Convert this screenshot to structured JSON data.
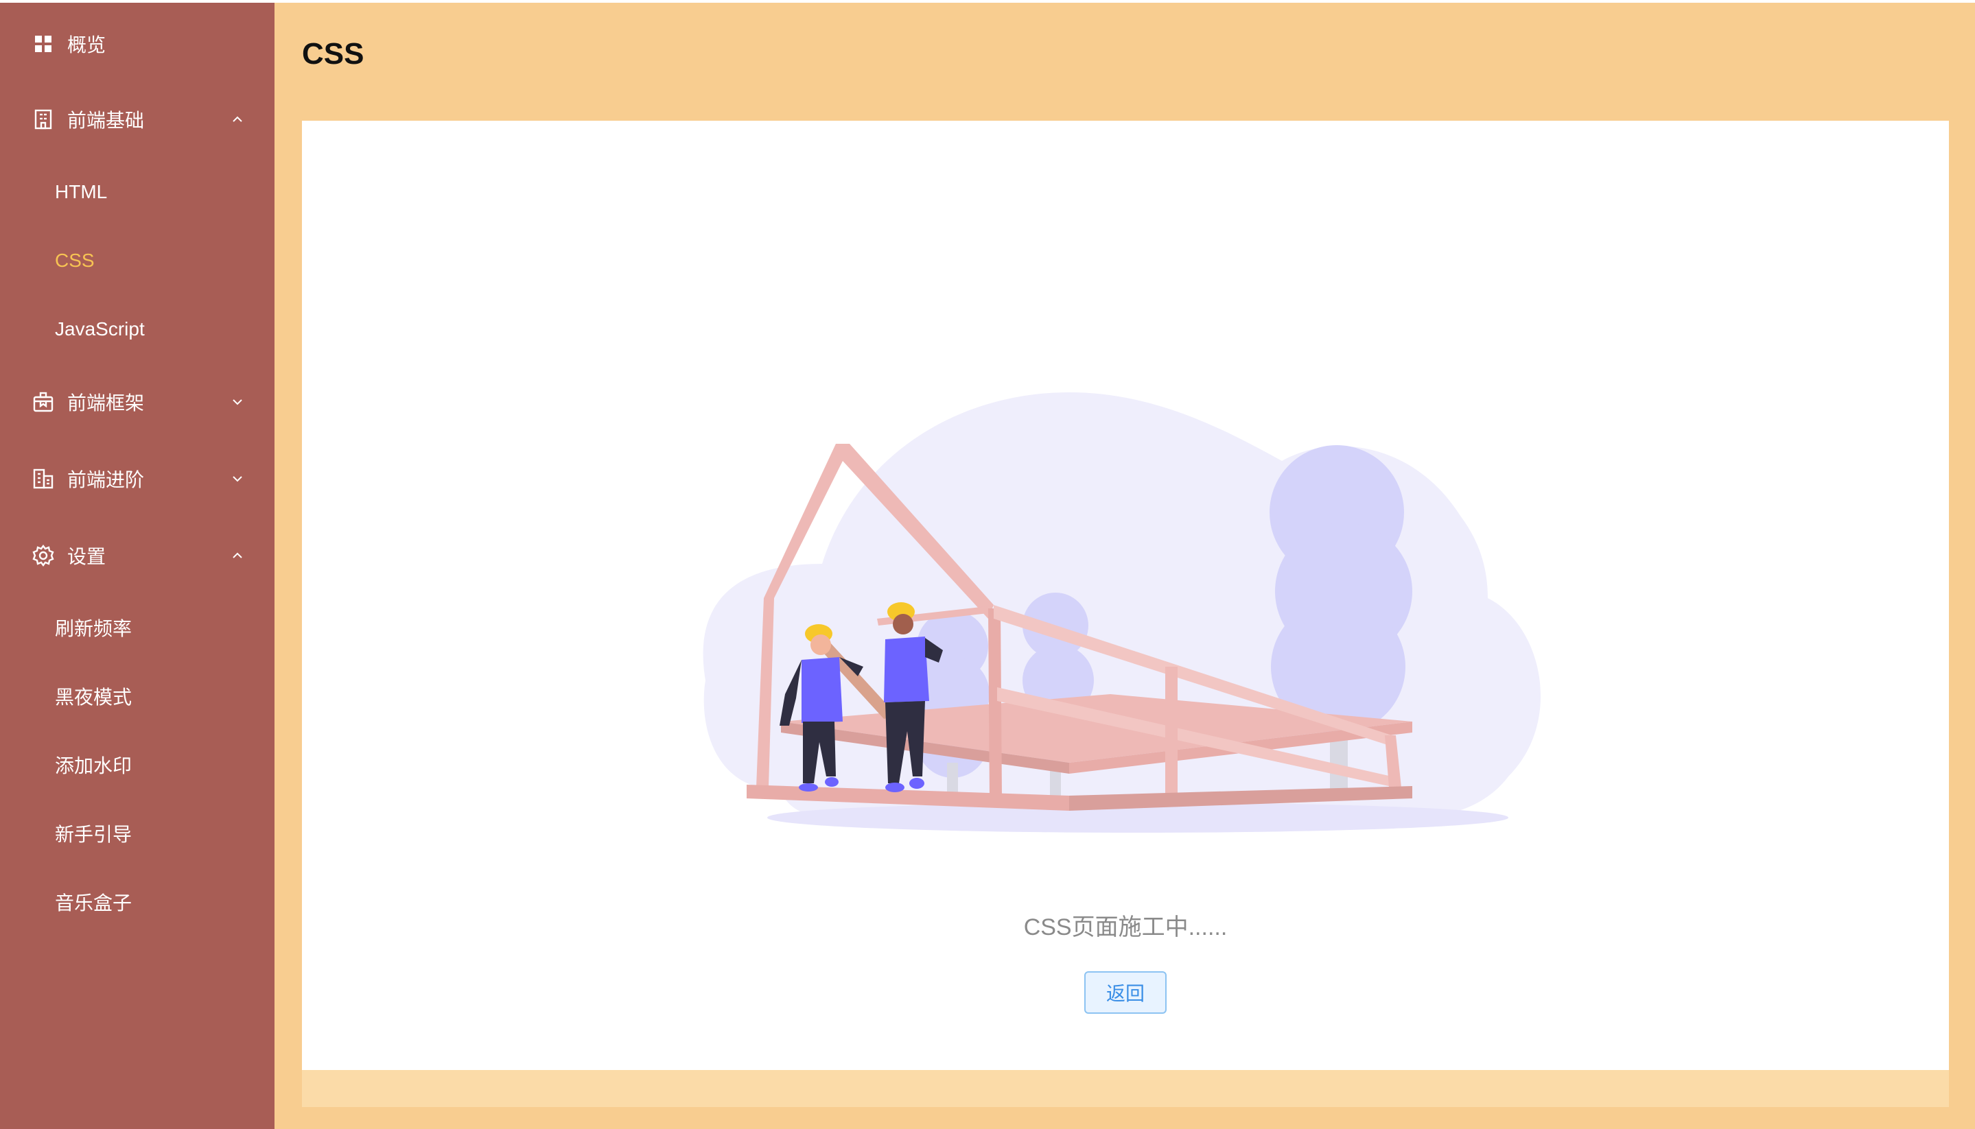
{
  "sidebar": {
    "items": [
      {
        "label": "概览",
        "icon": "grid-icon"
      },
      {
        "label": "前端基础",
        "icon": "building-icon",
        "expanded": true,
        "children": [
          {
            "label": "HTML"
          },
          {
            "label": "CSS",
            "active": true
          },
          {
            "label": "JavaScript"
          }
        ]
      },
      {
        "label": "前端框架",
        "icon": "box-icon",
        "expanded": false
      },
      {
        "label": "前端进阶",
        "icon": "office-icon",
        "expanded": false
      },
      {
        "label": "设置",
        "icon": "gear-icon",
        "expanded": true,
        "children": [
          {
            "label": "刷新频率"
          },
          {
            "label": "黑夜模式"
          },
          {
            "label": "添加水印"
          },
          {
            "label": "新手引导"
          },
          {
            "label": "音乐盒子"
          }
        ]
      }
    ],
    "active_color": "#f7c353",
    "background": "#a85d55"
  },
  "main": {
    "title": "CSS",
    "status_text": "CSS页面施工中......",
    "back_button": "返回",
    "background": "#f8cd90"
  }
}
